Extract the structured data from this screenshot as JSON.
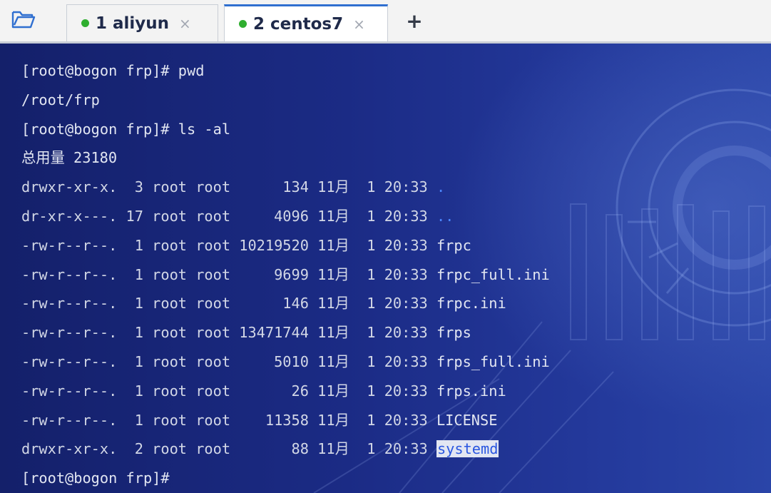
{
  "tabs": [
    {
      "label": "1 aliyun",
      "close": "×",
      "active": false,
      "status_color": "#2fae2f"
    },
    {
      "label": "2 centos7",
      "close": "×",
      "active": true,
      "status_color": "#2fae2f"
    }
  ],
  "add_tab_label": "+",
  "terminal": {
    "lines": [
      {
        "text": "[root@bogon frp]# pwd"
      },
      {
        "text": "/root/frp"
      },
      {
        "text": "[root@bogon frp]# ls -al"
      },
      {
        "text": "总用量 23180"
      }
    ],
    "listing": [
      {
        "prefix": "drwxr-xr-x.  3 root root      134 11月  1 20:33 ",
        "name": "."
      },
      {
        "prefix": "dr-xr-x---. 17 root root     4096 11月  1 20:33 ",
        "name": ".."
      },
      {
        "prefix": "-rw-r--r--.  1 root root 10219520 11月  1 20:33 ",
        "name": "frpc"
      },
      {
        "prefix": "-rw-r--r--.  1 root root     9699 11月  1 20:33 ",
        "name": "frpc_full.ini"
      },
      {
        "prefix": "-rw-r--r--.  1 root root      146 11月  1 20:33 ",
        "name": "frpc.ini"
      },
      {
        "prefix": "-rw-r--r--.  1 root root 13471744 11月  1 20:33 ",
        "name": "frps"
      },
      {
        "prefix": "-rw-r--r--.  1 root root     5010 11月  1 20:33 ",
        "name": "frps_full.ini"
      },
      {
        "prefix": "-rw-r--r--.  1 root root       26 11月  1 20:33 ",
        "name": "frps.ini"
      },
      {
        "prefix": "-rw-r--r--.  1 root root    11358 11月  1 20:33 ",
        "name": "LICENSE"
      },
      {
        "prefix": "drwxr-xr-x.  2 root root       88 11月  1 20:33 ",
        "name": "systemd"
      }
    ],
    "prompt": "[root@bogon frp]#"
  }
}
